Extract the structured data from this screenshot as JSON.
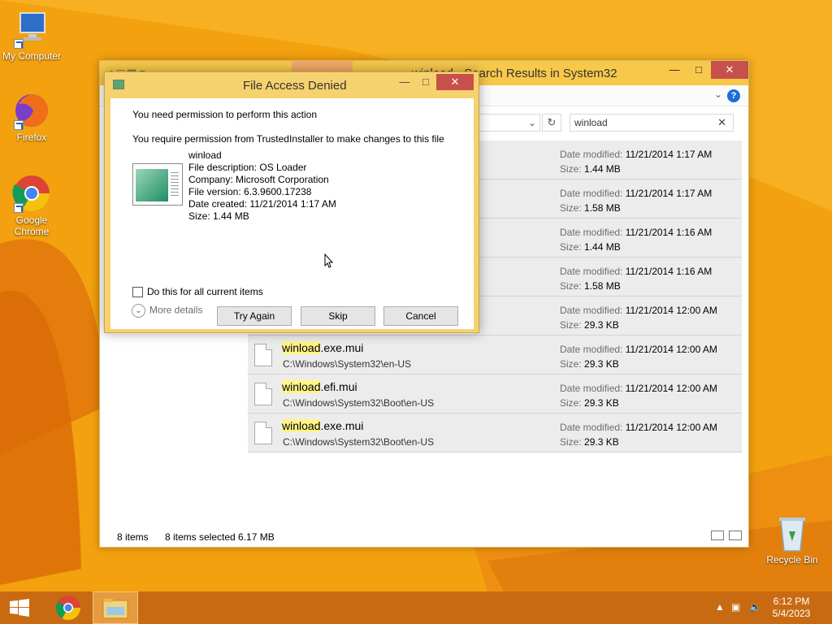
{
  "desktop": {
    "icons": [
      {
        "label": "My Computer"
      },
      {
        "label": "Firefox"
      },
      {
        "label": "Google Chrome"
      },
      {
        "label": "Recycle Bin"
      }
    ]
  },
  "explorer": {
    "title": "winload - Search Results in System32",
    "search_value": "winload",
    "status_items": "8 items",
    "status_selected": "8 items selected  6.17 MB",
    "labels": {
      "date_modified": "Date modified:",
      "size": "Size:"
    },
    "rows": [
      {
        "highlight": "",
        "rest": "",
        "path": "",
        "date": "11/21/2014 1:17 AM",
        "size": "1.44 MB"
      },
      {
        "highlight": "",
        "rest": "",
        "path": "",
        "date": "11/21/2014 1:17 AM",
        "size": "1.58 MB"
      },
      {
        "highlight": "",
        "rest": "",
        "path": "",
        "date": "11/21/2014 1:16 AM",
        "size": "1.44 MB"
      },
      {
        "highlight": "",
        "rest": "",
        "path": "",
        "date": "11/21/2014 1:16 AM",
        "size": "1.58 MB"
      },
      {
        "highlight": "",
        "rest": "",
        "path": "",
        "date": "11/21/2014 12:00 AM",
        "size": "29.3 KB"
      },
      {
        "highlight": "winload",
        "rest": ".exe.mui",
        "path": "C:\\Windows\\System32\\en-US",
        "date": "11/21/2014 12:00 AM",
        "size": "29.3 KB"
      },
      {
        "highlight": "winload",
        "rest": ".efi.mui",
        "path": "C:\\Windows\\System32\\Boot\\en-US",
        "date": "11/21/2014 12:00 AM",
        "size": "29.3 KB"
      },
      {
        "highlight": "winload",
        "rest": ".exe.mui",
        "path": "C:\\Windows\\System32\\Boot\\en-US",
        "date": "11/21/2014 12:00 AM",
        "size": "29.3 KB"
      }
    ]
  },
  "dialog": {
    "title": "File Access Denied",
    "line1": "You need permission to perform this action",
    "line2": "You require permission from TrustedInstaller to make changes to this file",
    "file_name": "winload",
    "file_description": "File description: OS Loader",
    "company": "Company: Microsoft Corporation",
    "file_version": "File version: 6.3.9600.17238",
    "date_created": "Date created: 11/21/2014 1:17 AM",
    "size": "Size: 1.44 MB",
    "checkbox_label": "Do this for all current items",
    "btn_try": "Try Again",
    "btn_skip": "Skip",
    "btn_cancel": "Cancel",
    "more_details": "More details"
  },
  "taskbar": {
    "time": "6:12 PM",
    "date": "5/4/2023"
  },
  "colors": {
    "desktop": "#f4a20c",
    "taskbar": "#c86a11",
    "close": "#c7504a",
    "highlight": "#fff48a"
  }
}
